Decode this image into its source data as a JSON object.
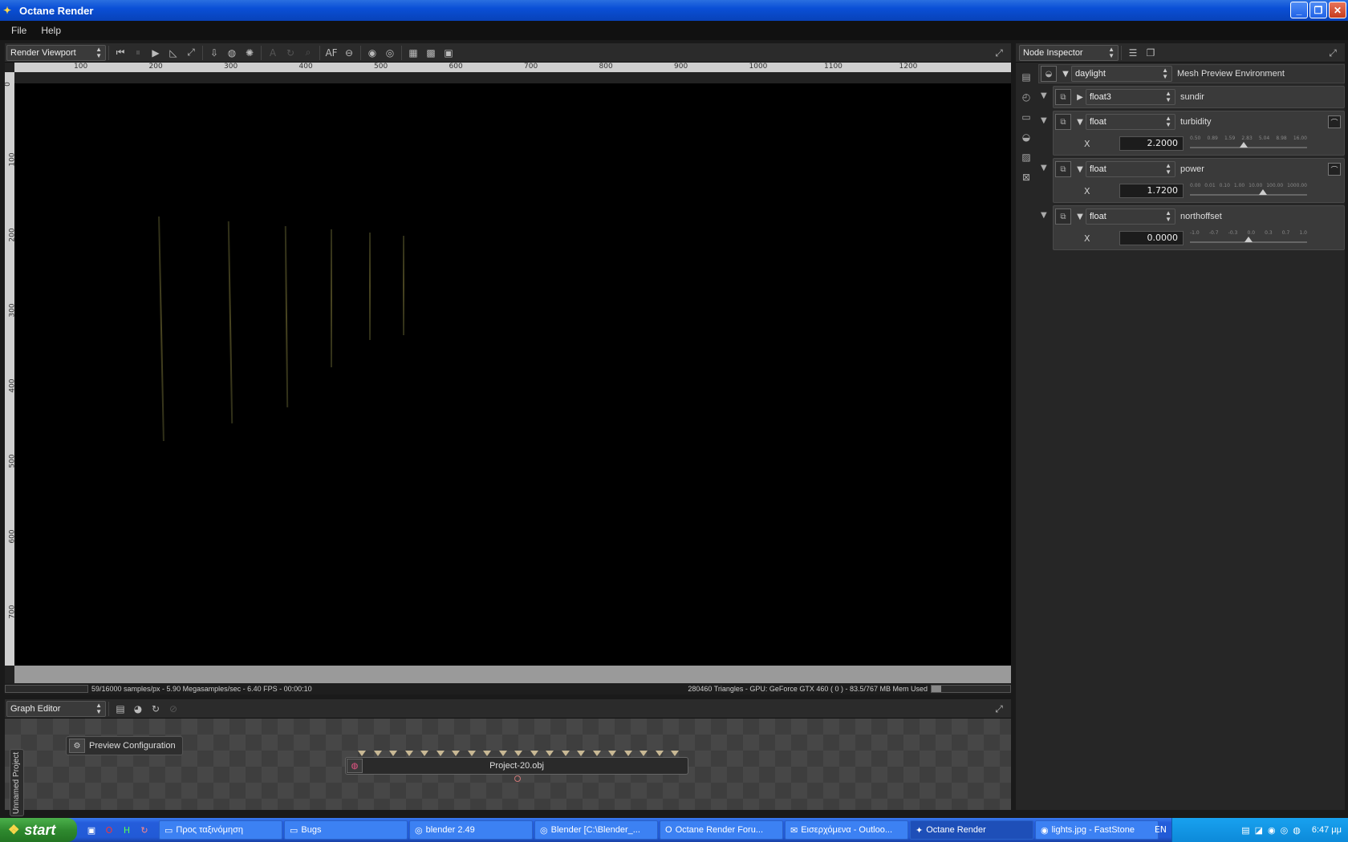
{
  "window": {
    "title": "Octane Render"
  },
  "menu": [
    "File",
    "Help"
  ],
  "viewport": {
    "mode": "Render Viewport",
    "ruler_h": [
      "100",
      "200",
      "300",
      "400",
      "500",
      "600",
      "700",
      "800",
      "900",
      "1000",
      "1100",
      "1200"
    ],
    "ruler_v": [
      "0",
      "100",
      "200",
      "300",
      "400",
      "500",
      "600",
      "700"
    ],
    "toolbar_af_label": "AF",
    "status_left": "59/16000 samples/px - 5.90 Megasamples/sec - 6.40 FPS - 00:00:10",
    "status_right": "280460 Triangles - GPU: GeForce GTX 460 ( 0 ) - 83.5/767 MB Mem Used"
  },
  "inspector": {
    "mode": "Node Inspector",
    "root": {
      "type": "daylight",
      "label": "Mesh Preview Environment"
    },
    "nodes": [
      {
        "type": "float3",
        "label": "sundir"
      },
      {
        "type": "float",
        "label": "turbidity",
        "axis": "X",
        "value": "2.2000",
        "ticks": [
          "0.50",
          "0.89",
          "1.59",
          "2.83",
          "5.04",
          "8.98",
          "16.00"
        ],
        "level": 0.46
      },
      {
        "type": "float",
        "label": "power",
        "axis": "X",
        "value": "1.7200",
        "ticks": [
          "0.00",
          "0.01",
          "0.10",
          "1.00",
          "10.00",
          "100.00",
          "1000.00"
        ],
        "level": 0.62
      },
      {
        "type": "float",
        "label": "northoffset",
        "axis": "X",
        "value": "0.0000",
        "ticks": [
          "-1.0",
          "-0.7",
          "-0.3",
          "0.0",
          "0.3",
          "0.7",
          "1.0"
        ],
        "level": 0.5
      }
    ]
  },
  "graph_editor": {
    "mode": "Graph Editor",
    "side_tab": "Unnamed Project",
    "preview_node": "Preview Configuration",
    "mesh_node": "Project-20.obj"
  },
  "taskbar": {
    "start": "start",
    "tasks": [
      {
        "icon": "folder-icon",
        "label": "Προς ταξινόμηση"
      },
      {
        "icon": "folder-icon",
        "label": "Bugs"
      },
      {
        "icon": "blender-icon",
        "label": "blender 2.49"
      },
      {
        "icon": "blender-icon",
        "label": "Blender [C:\\Blender_..."
      },
      {
        "icon": "opera-icon",
        "label": "Octane Render Foru..."
      },
      {
        "icon": "outlook-icon",
        "label": "Εισερχόμενα - Outloo..."
      },
      {
        "icon": "octane-icon",
        "label": "Octane Render"
      },
      {
        "icon": "faststone-icon",
        "label": "lights.jpg - FastStone"
      }
    ],
    "language": "EN",
    "clock": "6:47 μμ"
  },
  "colors": {
    "titlebar": "#0a4fd6",
    "taskbar": "#245ddb",
    "start": "#2f8a2f",
    "panel": "#262626"
  }
}
